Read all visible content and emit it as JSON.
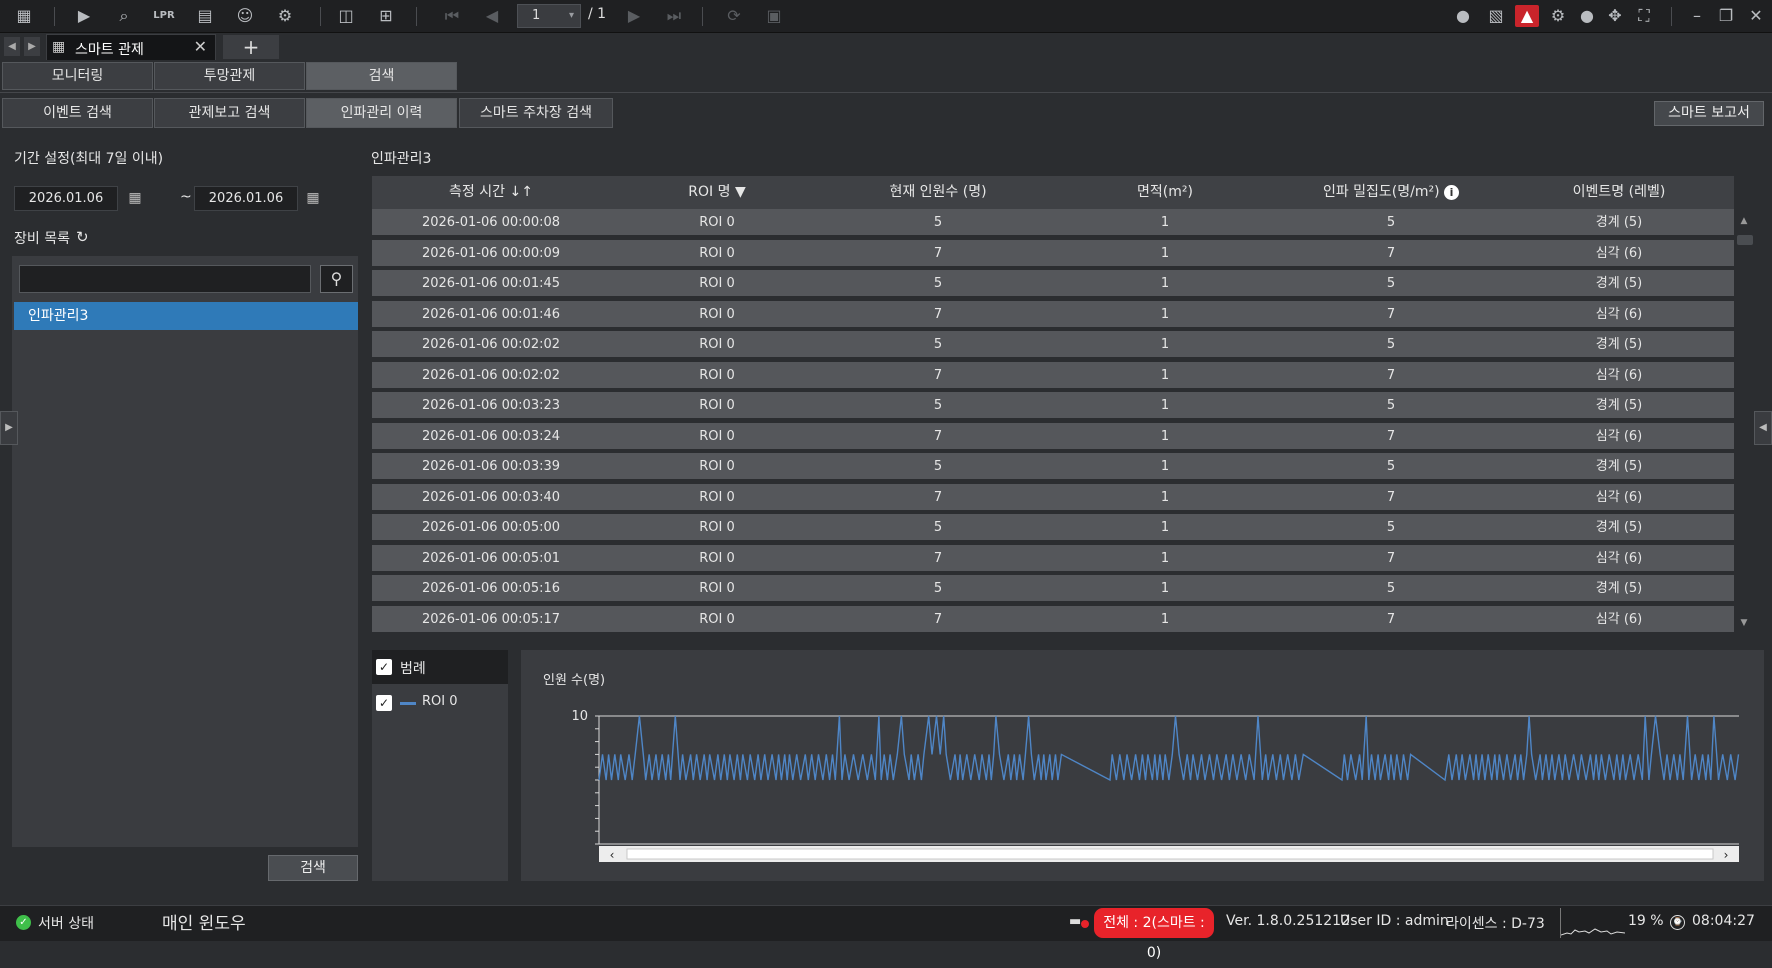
{
  "toolbar": {
    "page_value": "1",
    "page_total": "/ 1"
  },
  "window_tab": {
    "label": "스마트 관제"
  },
  "mode_tabs": [
    {
      "label": "모니터링"
    },
    {
      "label": "투망관제"
    },
    {
      "label": "검색"
    }
  ],
  "sub_tabs": [
    {
      "label": "이벤트 검색"
    },
    {
      "label": "관제보고 검색"
    },
    {
      "label": "인파관리 이력"
    },
    {
      "label": "스마트 주차장 검색"
    }
  ],
  "report_button": "스마트 보고서",
  "left": {
    "period_label": "기간 설정(최대 7일 이내)",
    "date_from": "2026.01.06",
    "date_sep": "~",
    "date_to": "2026.01.06",
    "device_list_label": "장비 목록",
    "device_search_value": "",
    "devices": [
      "인파관리3"
    ],
    "search_button": "검색"
  },
  "table": {
    "title": "인파관리3",
    "headers": [
      "측정 시간",
      "ROI 명",
      "현재 인원수 (명)",
      "면적(m²)",
      "인파 밀집도(명/m²)",
      "이벤트명 (레벨)"
    ],
    "rows": [
      [
        "2026-01-06 00:00:08",
        "ROI 0",
        "5",
        "1",
        "5",
        "경계 (5)"
      ],
      [
        "2026-01-06 00:00:09",
        "ROI 0",
        "7",
        "1",
        "7",
        "심각 (6)"
      ],
      [
        "2026-01-06 00:01:45",
        "ROI 0",
        "5",
        "1",
        "5",
        "경계 (5)"
      ],
      [
        "2026-01-06 00:01:46",
        "ROI 0",
        "7",
        "1",
        "7",
        "심각 (6)"
      ],
      [
        "2026-01-06 00:02:02",
        "ROI 0",
        "5",
        "1",
        "5",
        "경계 (5)"
      ],
      [
        "2026-01-06 00:02:02",
        "ROI 0",
        "7",
        "1",
        "7",
        "심각 (6)"
      ],
      [
        "2026-01-06 00:03:23",
        "ROI 0",
        "5",
        "1",
        "5",
        "경계 (5)"
      ],
      [
        "2026-01-06 00:03:24",
        "ROI 0",
        "7",
        "1",
        "7",
        "심각 (6)"
      ],
      [
        "2026-01-06 00:03:39",
        "ROI 0",
        "5",
        "1",
        "5",
        "경계 (5)"
      ],
      [
        "2026-01-06 00:03:40",
        "ROI 0",
        "7",
        "1",
        "7",
        "심각 (6)"
      ],
      [
        "2026-01-06 00:05:00",
        "ROI 0",
        "5",
        "1",
        "5",
        "경계 (5)"
      ],
      [
        "2026-01-06 00:05:01",
        "ROI 0",
        "7",
        "1",
        "7",
        "심각 (6)"
      ],
      [
        "2026-01-06 00:05:16",
        "ROI 0",
        "5",
        "1",
        "5",
        "경계 (5)"
      ],
      [
        "2026-01-06 00:05:17",
        "ROI 0",
        "7",
        "1",
        "7",
        "심각 (6)"
      ]
    ]
  },
  "legend": {
    "title": "범례",
    "items": [
      {
        "name": "ROI 0",
        "color": "#4f86c6"
      }
    ]
  },
  "chart_data": {
    "type": "line",
    "ylabel": "인원 수(명)",
    "ytick_labels": [
      "10"
    ],
    "ylim": [
      0,
      10
    ],
    "threshold_line": 10,
    "series": [
      {
        "name": "ROI 0",
        "color": "#4f86c6",
        "min": 5,
        "max": 7,
        "peak": 10
      }
    ]
  },
  "status": {
    "server_status": "서버 상태",
    "main_window": "매인 윈도우",
    "total_badge": "전체 : 2(스마트 : 0)",
    "version": "Ver. 1.8.0.251212",
    "user_id": "User ID : admin",
    "license": "라이센스 : D-73",
    "cpu": "19 %",
    "clock": "08:04:27"
  }
}
